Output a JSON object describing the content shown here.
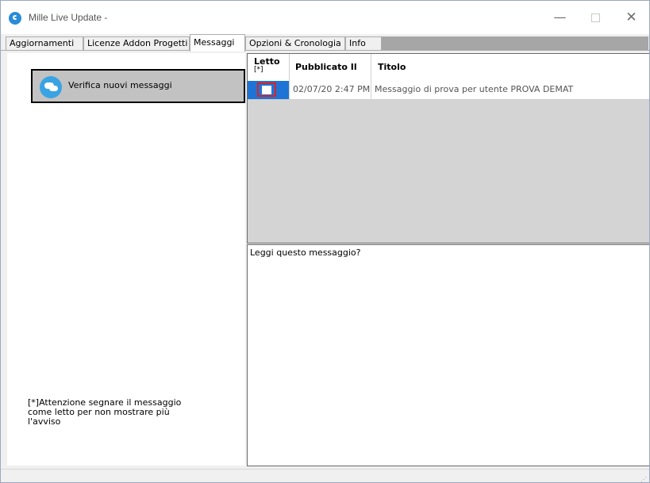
{
  "window": {
    "title": "Mille Live Update -",
    "controls": {
      "minimize": "—",
      "maximize": "",
      "close": "✕"
    }
  },
  "tabs": [
    {
      "label": "Aggiornamenti",
      "active": false
    },
    {
      "label": "Licenze Addon Progetti",
      "active": false
    },
    {
      "label": "Messaggi",
      "active": true
    },
    {
      "label": "Opzioni & Cronologia",
      "active": false
    },
    {
      "label": "Info",
      "active": false
    }
  ],
  "left": {
    "verify_button": "Verifica nuovi messaggi",
    "warning_line1": "[*]Attenzione segnare il messaggio",
    "warning_line2": "come letto per  non mostrare più",
    "warning_line3": "l'avviso"
  },
  "grid": {
    "columns": {
      "read_line1": "Letto",
      "read_line2": "[*]",
      "published": "Pubblicato Il",
      "title": "Titolo"
    },
    "rows": [
      {
        "read": false,
        "published": "02/07/20 2:47 PM",
        "title": "Messaggio di prova per utente PROVA DEMAT"
      }
    ]
  },
  "preview": {
    "text": "Leggi questo messaggio?"
  },
  "colors": {
    "selection": "#1e74d6",
    "highlight_border": "#e02020",
    "grid_background": "#d4d4d4",
    "button_background": "#c2c2c2"
  },
  "icons": {
    "app": "app-logo-icon",
    "verify": "message-bubbles-icon"
  }
}
